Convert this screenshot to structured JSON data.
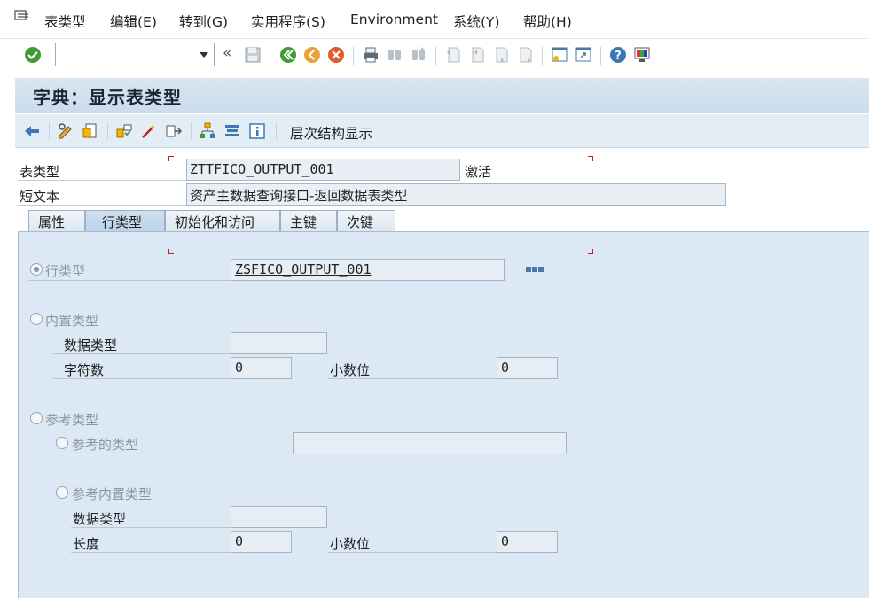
{
  "menu": {
    "items": [
      "表类型",
      "编辑(E)",
      "转到(G)",
      "实用程序(S)",
      "Environment",
      "系统(Y)",
      "帮助(H)"
    ]
  },
  "system_toolbar": {
    "command_field_value": "",
    "icons": [
      "enter-icon",
      "command-dropdown-icon",
      "collapse-icon",
      "save-icon",
      "back-icon",
      "exit-icon",
      "cancel-icon",
      "print-icon",
      "find-icon",
      "find-next-icon",
      "first-page-icon",
      "previous-page-icon",
      "next-page-icon",
      "last-page-icon",
      "new-session-icon",
      "shortcut-icon",
      "help-icon",
      "customize-layout-icon"
    ]
  },
  "title": "字典：显示表类型",
  "app_toolbar": {
    "label": "层次结构显示",
    "icons": [
      "back-arrow-icon",
      "display-change-icon",
      "other-object-icon",
      "check-icon",
      "activate-icon",
      "where-used-icon",
      "object-list-icon",
      "navigation-window-icon",
      "info-icon"
    ]
  },
  "header": {
    "table_type_label": "表类型",
    "table_type_value": "ZTTFICO_OUTPUT_001",
    "status": "激活",
    "short_text_label": "短文本",
    "short_text_value": "资产主数据查询接口-返回数据表类型"
  },
  "tabs": [
    "属性",
    "行类型",
    "初始化和访问",
    "主键",
    "次键"
  ],
  "active_tab": "行类型",
  "row_type_tab": {
    "row_type_label": "行类型",
    "row_type_value": "ZSFICO_OUTPUT_001",
    "builtin_label": "内置类型",
    "data_type_label": "数据类型",
    "data_type_value": "",
    "chars_label": "字符数",
    "chars_value": "0",
    "decimals_label": "小数位",
    "decimals_value": "0",
    "ref_type_label": "参考类型",
    "ref_to_type_label": "参考的类型",
    "ref_to_type_value": "",
    "ref_builtin_label": "参考内置类型",
    "ref_data_type_label": "数据类型",
    "ref_data_type_value": "",
    "length_label": "长度",
    "length_value": "0",
    "ref_decimals_label": "小数位",
    "ref_decimals_value": "0"
  },
  "colors": {
    "title_bg": "#cbdcec",
    "toolbar_bg": "#e3edf6",
    "tab_area_bg": "#dce8f3",
    "corner_marker": "#b3261e"
  }
}
